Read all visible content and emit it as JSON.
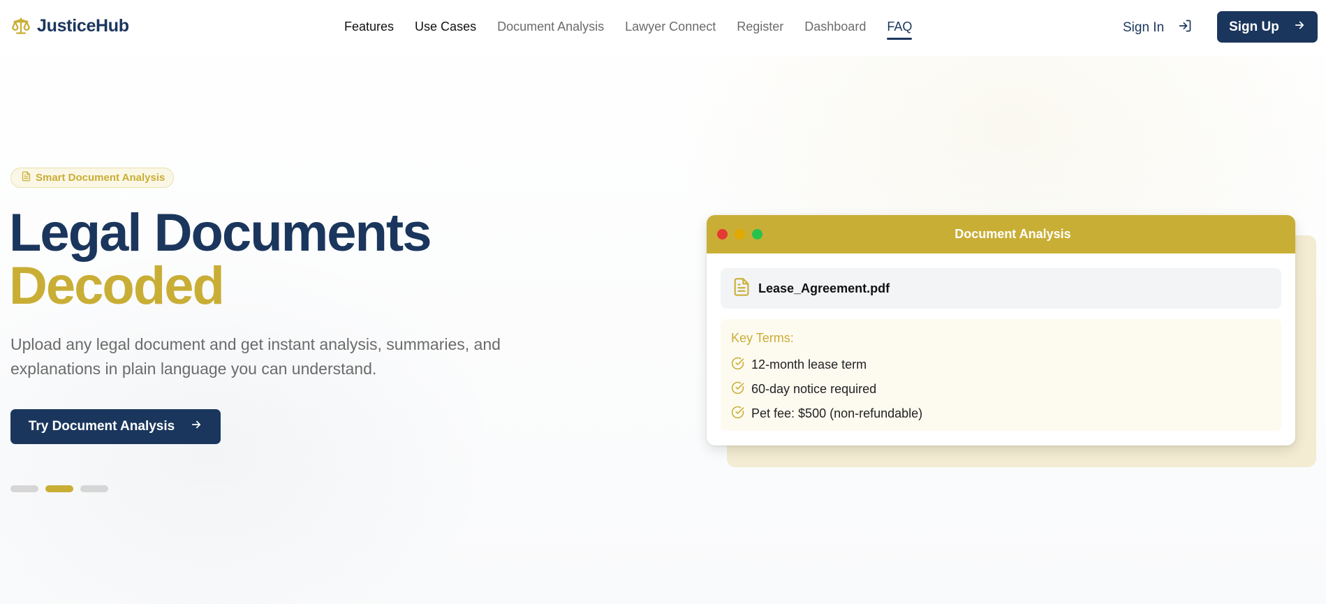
{
  "brand": {
    "name": "JusticeHub",
    "logo_icon": "scales-icon",
    "accent": "#c9ae36",
    "primary": "#1b365d"
  },
  "nav": {
    "links": [
      {
        "label": "Features"
      },
      {
        "label": "Use Cases"
      },
      {
        "label": "Document Analysis"
      },
      {
        "label": "Lawyer Connect"
      },
      {
        "label": "Register"
      },
      {
        "label": "Dashboard"
      },
      {
        "label": "FAQ"
      }
    ],
    "active": "FAQ",
    "sign_in": "Sign In",
    "sign_up": "Sign Up"
  },
  "hero": {
    "badge": "Smart Document Analysis",
    "headline_line1": "Legal Documents",
    "headline_line2": "Decoded",
    "subtext": "Upload any legal document and get instant analysis, summaries, and explanations in plain language you can understand.",
    "cta": "Try Document Analysis",
    "carousel": {
      "count": 3,
      "active_index": 1
    }
  },
  "doc_card": {
    "title": "Document Analysis",
    "file_name": "Lease_Agreement.pdf",
    "terms_title": "Key Terms:",
    "terms": [
      "12-month lease term",
      "60-day notice required",
      "Pet fee: $500 (non-refundable)"
    ]
  }
}
